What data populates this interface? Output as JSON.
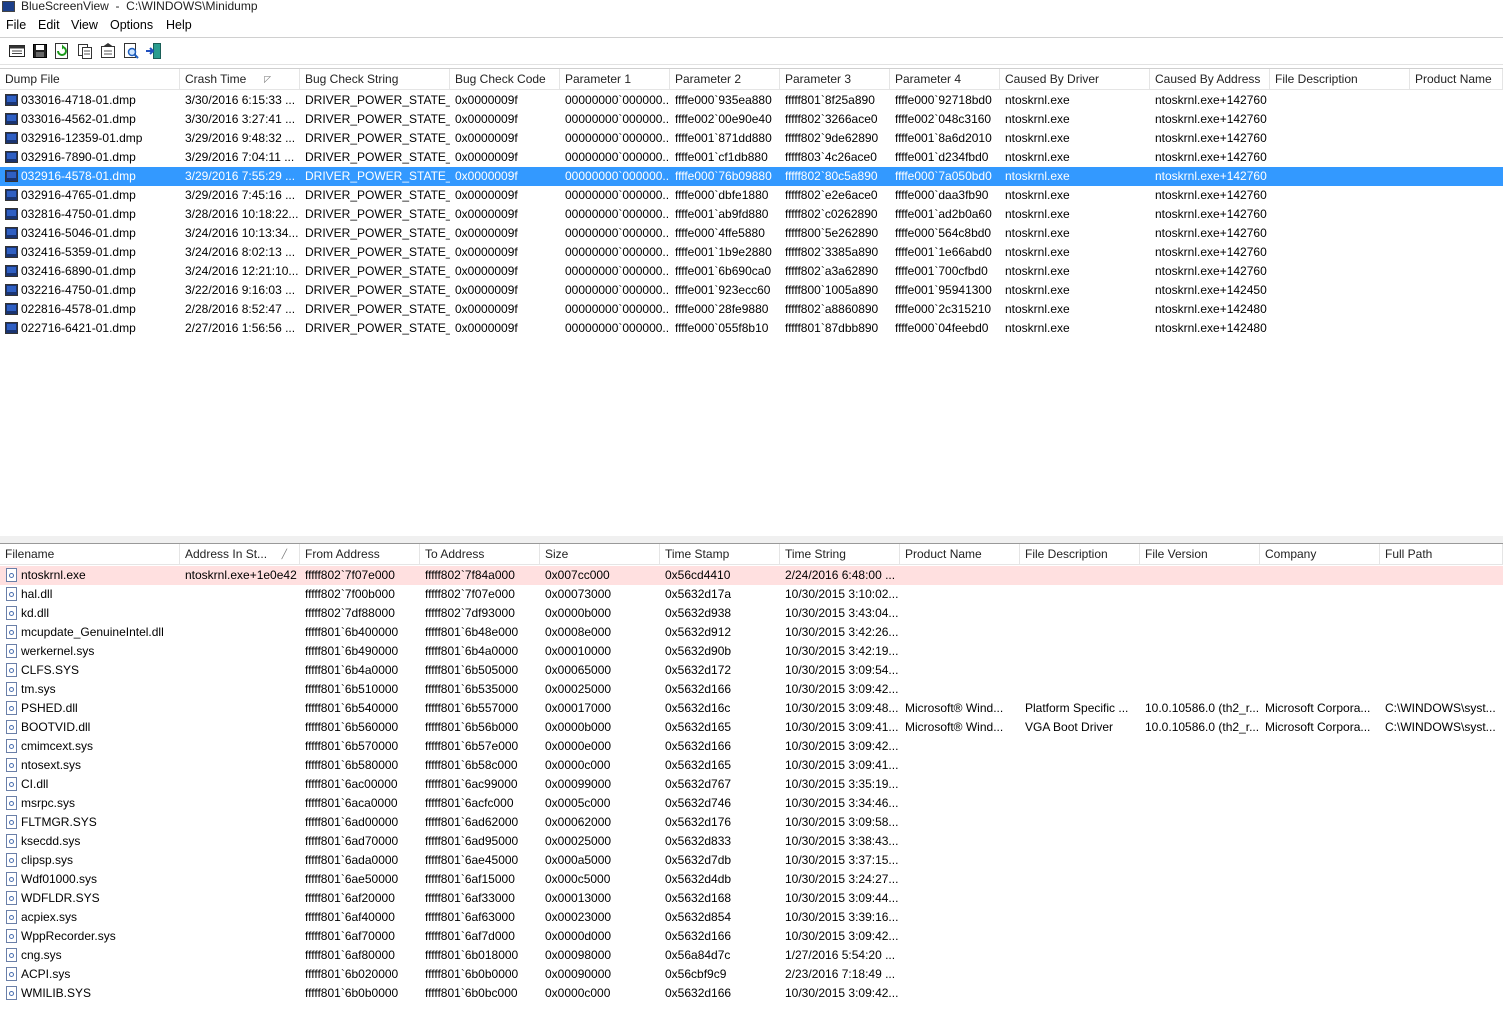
{
  "window": {
    "title": "BlueScreenView  -  C:\\WINDOWS\\Minidump"
  },
  "menu": [
    "File",
    "Edit",
    "View",
    "Options",
    "Help"
  ],
  "toolbar_icons": [
    "properties-icon",
    "save-icon",
    "refresh-icon",
    "copy-icon",
    "html-report-icon",
    "find-icon",
    "exit-icon"
  ],
  "top": {
    "columns": [
      "Dump File",
      "Crash Time",
      "Bug Check String",
      "Bug Check Code",
      "Parameter 1",
      "Parameter 2",
      "Parameter 3",
      "Parameter 4",
      "Caused By Driver",
      "Caused By Address",
      "File Description",
      "Product Name"
    ],
    "rows": [
      [
        "033016-4718-01.dmp",
        "3/30/2016 6:15:33 ...",
        "DRIVER_POWER_STATE_...",
        "0x0000009f",
        "00000000`000000...",
        "ffffe000`935ea880",
        "fffff801`8f25a890",
        "ffffe000`92718bd0",
        "ntoskrnl.exe",
        "ntoskrnl.exe+142760",
        "",
        ""
      ],
      [
        "033016-4562-01.dmp",
        "3/30/2016 3:27:41 ...",
        "DRIVER_POWER_STATE_...",
        "0x0000009f",
        "00000000`000000...",
        "ffffe002`00e90e40",
        "fffff802`3266ace0",
        "ffffe002`048c3160",
        "ntoskrnl.exe",
        "ntoskrnl.exe+142760",
        "",
        ""
      ],
      [
        "032916-12359-01.dmp",
        "3/29/2016 9:48:32 ...",
        "DRIVER_POWER_STATE_...",
        "0x0000009f",
        "00000000`000000...",
        "ffffe001`871dd880",
        "fffff802`9de62890",
        "ffffe001`8a6d2010",
        "ntoskrnl.exe",
        "ntoskrnl.exe+142760",
        "",
        ""
      ],
      [
        "032916-7890-01.dmp",
        "3/29/2016 7:04:11 ...",
        "DRIVER_POWER_STATE_...",
        "0x0000009f",
        "00000000`000000...",
        "ffffe001`cf1db880",
        "fffff803`4c26ace0",
        "ffffe001`d234fbd0",
        "ntoskrnl.exe",
        "ntoskrnl.exe+142760",
        "",
        ""
      ],
      [
        "032916-4578-01.dmp",
        "3/29/2016 7:55:29 ...",
        "DRIVER_POWER_STATE_...",
        "0x0000009f",
        "00000000`000000...",
        "ffffe000`76b09880",
        "fffff802`80c5a890",
        "ffffe000`7a050bd0",
        "ntoskrnl.exe",
        "ntoskrnl.exe+142760",
        "",
        ""
      ],
      [
        "032916-4765-01.dmp",
        "3/29/2016 7:45:16 ...",
        "DRIVER_POWER_STATE_...",
        "0x0000009f",
        "00000000`000000...",
        "ffffe000`dbfe1880",
        "fffff802`e2e6ace0",
        "ffffe000`daa3fb90",
        "ntoskrnl.exe",
        "ntoskrnl.exe+142760",
        "",
        ""
      ],
      [
        "032816-4750-01.dmp",
        "3/28/2016 10:18:22...",
        "DRIVER_POWER_STATE_...",
        "0x0000009f",
        "00000000`000000...",
        "ffffe001`ab9fd880",
        "fffff802`c0262890",
        "ffffe001`ad2b0a60",
        "ntoskrnl.exe",
        "ntoskrnl.exe+142760",
        "",
        ""
      ],
      [
        "032416-5046-01.dmp",
        "3/24/2016 10:13:34...",
        "DRIVER_POWER_STATE_...",
        "0x0000009f",
        "00000000`000000...",
        "ffffe000`4ffe5880",
        "fffff800`5e262890",
        "ffffe000`564c8bd0",
        "ntoskrnl.exe",
        "ntoskrnl.exe+142760",
        "",
        ""
      ],
      [
        "032416-5359-01.dmp",
        "3/24/2016 8:02:13 ...",
        "DRIVER_POWER_STATE_...",
        "0x0000009f",
        "00000000`000000...",
        "ffffe001`1b9e2880",
        "fffff802`3385a890",
        "ffffe001`1e66abd0",
        "ntoskrnl.exe",
        "ntoskrnl.exe+142760",
        "",
        ""
      ],
      [
        "032416-6890-01.dmp",
        "3/24/2016 12:21:10...",
        "DRIVER_POWER_STATE_...",
        "0x0000009f",
        "00000000`000000...",
        "ffffe001`6b690ca0",
        "fffff802`a3a62890",
        "ffffe001`700cfbd0",
        "ntoskrnl.exe",
        "ntoskrnl.exe+142760",
        "",
        ""
      ],
      [
        "032216-4750-01.dmp",
        "3/22/2016 9:16:03 ...",
        "DRIVER_POWER_STATE_...",
        "0x0000009f",
        "00000000`000000...",
        "ffffe001`923ecc60",
        "fffff800`1005a890",
        "ffffe001`95941300",
        "ntoskrnl.exe",
        "ntoskrnl.exe+142450",
        "",
        ""
      ],
      [
        "022816-4578-01.dmp",
        "2/28/2016 8:52:47 ...",
        "DRIVER_POWER_STATE_...",
        "0x0000009f",
        "00000000`000000...",
        "ffffe000`28fe9880",
        "fffff802`a8860890",
        "ffffe000`2c315210",
        "ntoskrnl.exe",
        "ntoskrnl.exe+142480",
        "",
        ""
      ],
      [
        "022716-6421-01.dmp",
        "2/27/2016 1:56:56 ...",
        "DRIVER_POWER_STATE_...",
        "0x0000009f",
        "00000000`000000...",
        "ffffe000`055f8b10",
        "fffff801`87dbb890",
        "ffffe000`04feebd0",
        "ntoskrnl.exe",
        "ntoskrnl.exe+142480",
        "",
        ""
      ]
    ]
  },
  "bottom": {
    "columns": [
      "Filename",
      "Address In St...",
      "From Address",
      "To Address",
      "Size",
      "Time Stamp",
      "Time String",
      "Product Name",
      "File Description",
      "File Version",
      "Company",
      "Full Path"
    ],
    "rows": [
      [
        "ntoskrnl.exe",
        "ntoskrnl.exe+1e0e42",
        "fffff802`7f07e000",
        "fffff802`7f84a000",
        "0x007cc000",
        "0x56cd4410",
        "2/24/2016 6:48:00 ...",
        "",
        "",
        "",
        "",
        ""
      ],
      [
        "hal.dll",
        "",
        "fffff802`7f00b000",
        "fffff802`7f07e000",
        "0x00073000",
        "0x5632d17a",
        "10/30/2015 3:10:02...",
        "",
        "",
        "",
        "",
        ""
      ],
      [
        "kd.dll",
        "",
        "fffff802`7df88000",
        "fffff802`7df93000",
        "0x0000b000",
        "0x5632d938",
        "10/30/2015 3:43:04...",
        "",
        "",
        "",
        "",
        ""
      ],
      [
        "mcupdate_GenuineIntel.dll",
        "",
        "fffff801`6b400000",
        "fffff801`6b48e000",
        "0x0008e000",
        "0x5632d912",
        "10/30/2015 3:42:26...",
        "",
        "",
        "",
        "",
        ""
      ],
      [
        "werkernel.sys",
        "",
        "fffff801`6b490000",
        "fffff801`6b4a0000",
        "0x00010000",
        "0x5632d90b",
        "10/30/2015 3:42:19...",
        "",
        "",
        "",
        "",
        ""
      ],
      [
        "CLFS.SYS",
        "",
        "fffff801`6b4a0000",
        "fffff801`6b505000",
        "0x00065000",
        "0x5632d172",
        "10/30/2015 3:09:54...",
        "",
        "",
        "",
        "",
        ""
      ],
      [
        "tm.sys",
        "",
        "fffff801`6b510000",
        "fffff801`6b535000",
        "0x00025000",
        "0x5632d166",
        "10/30/2015 3:09:42...",
        "",
        "",
        "",
        "",
        ""
      ],
      [
        "PSHED.dll",
        "",
        "fffff801`6b540000",
        "fffff801`6b557000",
        "0x00017000",
        "0x5632d16c",
        "10/30/2015 3:09:48...",
        "Microsoft® Wind...",
        "Platform Specific ...",
        "10.0.10586.0 (th2_r...",
        "Microsoft Corpora...",
        "C:\\WINDOWS\\syst..."
      ],
      [
        "BOOTVID.dll",
        "",
        "fffff801`6b560000",
        "fffff801`6b56b000",
        "0x0000b000",
        "0x5632d165",
        "10/30/2015 3:09:41...",
        "Microsoft® Wind...",
        "VGA Boot Driver",
        "10.0.10586.0 (th2_r...",
        "Microsoft Corpora...",
        "C:\\WINDOWS\\syst..."
      ],
      [
        "cmimcext.sys",
        "",
        "fffff801`6b570000",
        "fffff801`6b57e000",
        "0x0000e000",
        "0x5632d166",
        "10/30/2015 3:09:42...",
        "",
        "",
        "",
        "",
        ""
      ],
      [
        "ntosext.sys",
        "",
        "fffff801`6b580000",
        "fffff801`6b58c000",
        "0x0000c000",
        "0x5632d165",
        "10/30/2015 3:09:41...",
        "",
        "",
        "",
        "",
        ""
      ],
      [
        "CI.dll",
        "",
        "fffff801`6ac00000",
        "fffff801`6ac99000",
        "0x00099000",
        "0x5632d767",
        "10/30/2015 3:35:19...",
        "",
        "",
        "",
        "",
        ""
      ],
      [
        "msrpc.sys",
        "",
        "fffff801`6aca0000",
        "fffff801`6acfc000",
        "0x0005c000",
        "0x5632d746",
        "10/30/2015 3:34:46...",
        "",
        "",
        "",
        "",
        ""
      ],
      [
        "FLTMGR.SYS",
        "",
        "fffff801`6ad00000",
        "fffff801`6ad62000",
        "0x00062000",
        "0x5632d176",
        "10/30/2015 3:09:58...",
        "",
        "",
        "",
        "",
        ""
      ],
      [
        "ksecdd.sys",
        "",
        "fffff801`6ad70000",
        "fffff801`6ad95000",
        "0x00025000",
        "0x5632d833",
        "10/30/2015 3:38:43...",
        "",
        "",
        "",
        "",
        ""
      ],
      [
        "clipsp.sys",
        "",
        "fffff801`6ada0000",
        "fffff801`6ae45000",
        "0x000a5000",
        "0x5632d7db",
        "10/30/2015 3:37:15...",
        "",
        "",
        "",
        "",
        ""
      ],
      [
        "Wdf01000.sys",
        "",
        "fffff801`6ae50000",
        "fffff801`6af15000",
        "0x000c5000",
        "0x5632d4db",
        "10/30/2015 3:24:27...",
        "",
        "",
        "",
        "",
        ""
      ],
      [
        "WDFLDR.SYS",
        "",
        "fffff801`6af20000",
        "fffff801`6af33000",
        "0x00013000",
        "0x5632d168",
        "10/30/2015 3:09:44...",
        "",
        "",
        "",
        "",
        ""
      ],
      [
        "acpiex.sys",
        "",
        "fffff801`6af40000",
        "fffff801`6af63000",
        "0x00023000",
        "0x5632d854",
        "10/30/2015 3:39:16...",
        "",
        "",
        "",
        "",
        ""
      ],
      [
        "WppRecorder.sys",
        "",
        "fffff801`6af70000",
        "fffff801`6af7d000",
        "0x0000d000",
        "0x5632d166",
        "10/30/2015 3:09:42...",
        "",
        "",
        "",
        "",
        ""
      ],
      [
        "cng.sys",
        "",
        "fffff801`6af80000",
        "fffff801`6b018000",
        "0x00098000",
        "0x56a84d7c",
        "1/27/2016 5:54:20 ...",
        "",
        "",
        "",
        "",
        ""
      ],
      [
        "ACPI.sys",
        "",
        "fffff801`6b020000",
        "fffff801`6b0b0000",
        "0x00090000",
        "0x56cbf9c9",
        "2/23/2016 7:18:49 ...",
        "",
        "",
        "",
        "",
        ""
      ],
      [
        "WMILIB.SYS",
        "",
        "fffff801`6b0b0000",
        "fffff801`6b0bc000",
        "0x0000c000",
        "0x5632d166",
        "10/30/2015 3:09:42...",
        "",
        "",
        "",
        "",
        ""
      ]
    ]
  }
}
